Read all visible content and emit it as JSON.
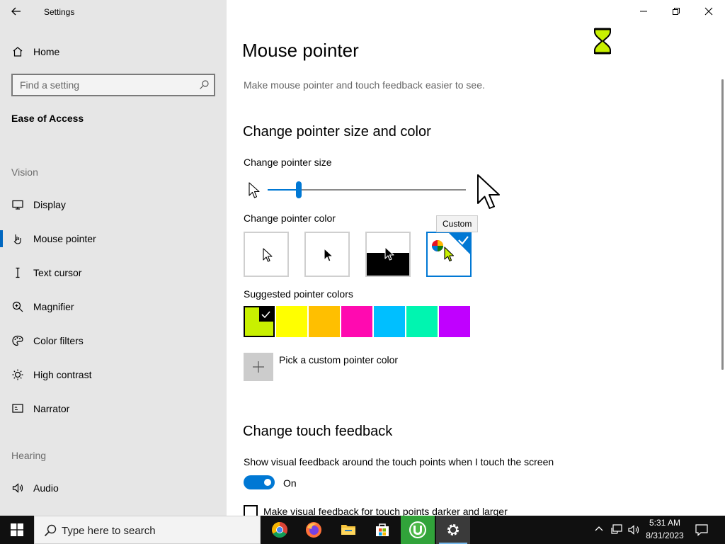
{
  "window": {
    "title": "Settings",
    "buttons": [
      "minimize",
      "restore",
      "close"
    ]
  },
  "sidebar": {
    "home_label": "Home",
    "search": {
      "placeholder": "Find a setting"
    },
    "category": "Ease of Access",
    "sections": [
      {
        "label": "Vision",
        "items": [
          {
            "label": "Display",
            "icon": "monitor-icon"
          },
          {
            "label": "Mouse pointer",
            "icon": "mouse-pointer-icon",
            "selected": true
          },
          {
            "label": "Text cursor",
            "icon": "text-cursor-icon"
          },
          {
            "label": "Magnifier",
            "icon": "magnifier-icon"
          },
          {
            "label": "Color filters",
            "icon": "color-filters-icon"
          },
          {
            "label": "High contrast",
            "icon": "high-contrast-icon"
          },
          {
            "label": "Narrator",
            "icon": "narrator-icon"
          }
        ]
      },
      {
        "label": "Hearing",
        "items": [
          {
            "label": "Audio",
            "icon": "speaker-icon"
          }
        ]
      }
    ]
  },
  "main": {
    "title": "Mouse pointer",
    "description": "Make mouse pointer and touch feedback easier to see.",
    "size_color_section": {
      "title": "Change pointer size and color",
      "size_label": "Change pointer size",
      "size_value": 0.08,
      "color_label": "Change pointer color",
      "color_options": [
        "white",
        "black",
        "inverted",
        "custom"
      ],
      "selected_color_option": "custom",
      "tooltip": "Custom",
      "suggested_label": "Suggested pointer colors",
      "suggested_colors": [
        "#c8f000",
        "#ffff00",
        "#ffbf00",
        "#ff0ab0",
        "#00bfff",
        "#00f5b0",
        "#c000ff"
      ],
      "selected_suggested_color": "#c8f000",
      "custom_color_label": "Pick a custom pointer color"
    },
    "touch_section": {
      "title": "Change touch feedback",
      "feedback_label": "Show visual feedback around the touch points when I touch the screen",
      "toggle_state": "On",
      "toggle_on": true,
      "darker_label": "Make visual feedback for touch points darker and larger",
      "darker_checked": false
    }
  },
  "taskbar": {
    "search_placeholder": "Type here to search",
    "apps": [
      "chrome-icon",
      "firefox-icon",
      "file-explorer-icon",
      "store-icon",
      "utorrent-icon",
      "settings-icon"
    ],
    "active_app": "settings-icon",
    "time": "5:31 AM",
    "date": "8/31/2023"
  },
  "colors": {
    "accent": "#0078d4",
    "sidebar_bg": "#e6e6e6",
    "taskbar_bg": "#101010"
  }
}
